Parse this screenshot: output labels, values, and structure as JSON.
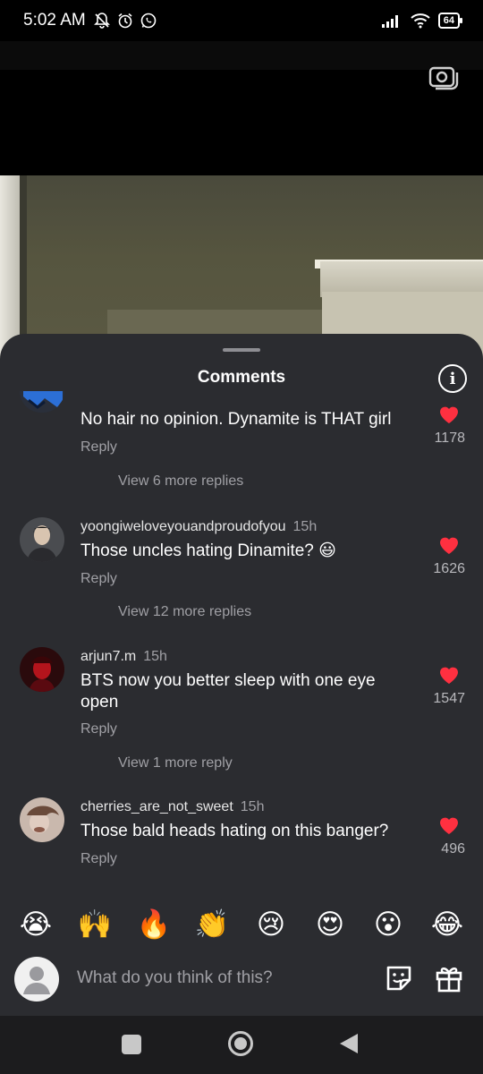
{
  "status_bar": {
    "time": "5:02 AM",
    "battery": "64",
    "left_icons": [
      "notification-off-icon",
      "alarm-icon",
      "whatsapp-icon"
    ],
    "right_icons": [
      "signal-icon",
      "wifi-icon",
      "battery-icon"
    ]
  },
  "sheet": {
    "title": "Comments",
    "info_icon": "info-icon"
  },
  "comments": [
    {
      "username": "",
      "time": "",
      "text": "No hair no opinion. Dynamite is THAT girl",
      "reply_label": "Reply",
      "likes": "1178",
      "view_more": "View 6 more replies"
    },
    {
      "username": "yoongiweloveyouandproudofyou",
      "time": "15h",
      "text": "Those uncles hating Dinamite? 😃",
      "reply_label": "Reply",
      "likes": "1626",
      "view_more": "View 12 more replies"
    },
    {
      "username": "arjun7.m",
      "time": "15h",
      "text": "BTS now you better sleep with one eye open",
      "reply_label": "Reply",
      "likes": "1547",
      "view_more": "View 1 more reply"
    },
    {
      "username": "cherries_are_not_sweet",
      "time": "15h",
      "text": "Those bald heads hating on this banger?",
      "reply_label": "Reply",
      "likes": "496",
      "view_more": ""
    }
  ],
  "reactions": [
    "😭",
    "🙌",
    "🔥",
    "👏",
    "😢",
    "😍",
    "😮",
    "😂"
  ],
  "input": {
    "placeholder": "What do you think of this?"
  },
  "colors": {
    "sheet_bg": "#2b2c30",
    "heart": "#ff3040",
    "secondary_text": "#a0a0a5"
  }
}
